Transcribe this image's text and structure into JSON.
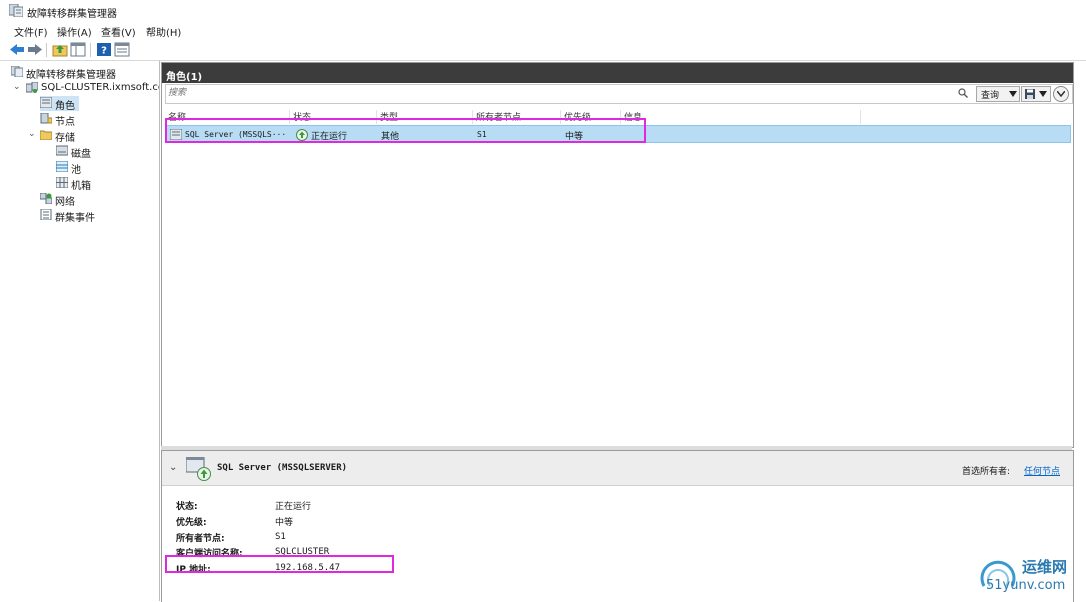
{
  "window": {
    "title": "故障转移群集管理器",
    "icon": "cluster-manager-icon"
  },
  "menu": [
    "文件(F)",
    "操作(A)",
    "查看(V)",
    "帮助(H)"
  ],
  "toolbar": [
    "back-arrow-icon",
    "forward-arrow-icon",
    "up-folder-icon",
    "show-hide-tree-icon",
    "help-icon",
    "properties-icon"
  ],
  "tree": {
    "root": "故障转移群集管理器",
    "cluster": "SQL-CLUSTER.ixmsoft.com",
    "items": [
      {
        "label": "角色",
        "selected": true
      },
      {
        "label": "节点"
      },
      {
        "label": "存储"
      },
      {
        "label": "磁盘"
      },
      {
        "label": "池"
      },
      {
        "label": "机箱"
      },
      {
        "label": "网络"
      },
      {
        "label": "群集事件"
      }
    ]
  },
  "roles": {
    "title": "角色(1)",
    "search_placeholder": "搜索",
    "query_label": "查询",
    "columns": [
      "名称",
      "状态",
      "类型",
      "所有者节点",
      "优先级",
      "信息"
    ],
    "rows": [
      {
        "name": "SQL Server (MSSQLS···",
        "status": "正在运行",
        "type": "其他",
        "owner": "S1",
        "priority": "中等",
        "info": ""
      }
    ]
  },
  "details": {
    "title": "SQL Server (MSSQLSERVER)",
    "preferred_owner_label": "首选所有者:",
    "preferred_owner_link": "任何节点",
    "props": [
      {
        "label": "状态:",
        "value": "正在运行"
      },
      {
        "label": "优先级:",
        "value": "中等"
      },
      {
        "label": "所有者节点:",
        "value": "S1"
      },
      {
        "label": "客户端访问名称:",
        "value": "SQLCLUSTER"
      },
      {
        "label": "IP 地址:",
        "value": "192.168.5.47"
      }
    ]
  },
  "watermark": {
    "line1": "运维网",
    "line2": "51yunv.com"
  },
  "colors": {
    "highlight_box": "#e028e0",
    "selected_row": "#b7dcf4",
    "header_dark": "#3c3c3c",
    "link": "#0066cc"
  }
}
